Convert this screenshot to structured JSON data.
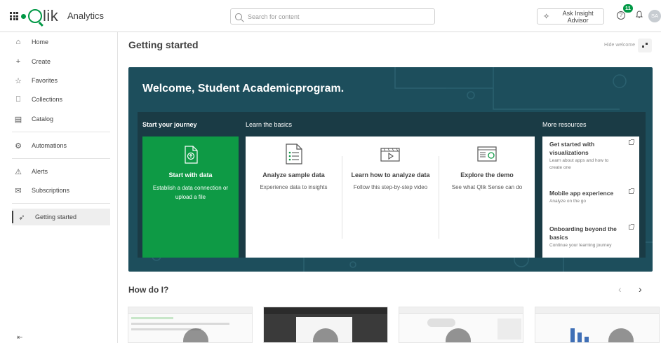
{
  "header": {
    "app_title": "Analytics",
    "logo_text": "lik",
    "search_placeholder": "Search for content",
    "insight_label": "Ask Insight Advisor",
    "notification_count": "11",
    "avatar_initials": "SA"
  },
  "sidebar": {
    "items": [
      {
        "label": "Home",
        "icon": "home-icon"
      },
      {
        "label": "Create",
        "icon": "plus-icon"
      },
      {
        "label": "Favorites",
        "icon": "star-icon"
      },
      {
        "label": "Collections",
        "icon": "bookmark-icon"
      },
      {
        "label": "Catalog",
        "icon": "catalog-icon"
      },
      {
        "label": "Automations",
        "icon": "automation-icon"
      },
      {
        "label": "Alerts",
        "icon": "alert-icon"
      },
      {
        "label": "Subscriptions",
        "icon": "mail-icon"
      },
      {
        "label": "Getting started",
        "icon": "rocket-icon"
      }
    ]
  },
  "main": {
    "page_title": "Getting started",
    "hide_welcome": "Hide welcome",
    "welcome_text": "Welcome, Student Academicprogram.",
    "sections": {
      "journey": "Start your journey",
      "basics": "Learn the basics",
      "resources": "More resources"
    },
    "start_card": {
      "title": "Start with data",
      "description": "Establish a data connection or upload a file"
    },
    "learn_cards": [
      {
        "title": "Analyze sample data",
        "description": "Experience data to insights"
      },
      {
        "title": "Learn how to analyze data",
        "description": "Follow this step-by-step video"
      },
      {
        "title": "Explore the demo",
        "description": "See what Qlik Sense can do"
      }
    ],
    "resources": [
      {
        "title": "Get started with visualizations",
        "description": "Learn about apps and how to create one"
      },
      {
        "title": "Mobile app experience",
        "description": "Analyze on the go"
      },
      {
        "title": "Onboarding beyond the basics",
        "description": "Continue your learning journey"
      }
    ],
    "howdo_title": "How do I?"
  },
  "colors": {
    "brand_green": "#009845",
    "hero_bg": "#1d4e5c",
    "strip_bg": "#1a3b45",
    "card_green": "#0e9a45"
  }
}
